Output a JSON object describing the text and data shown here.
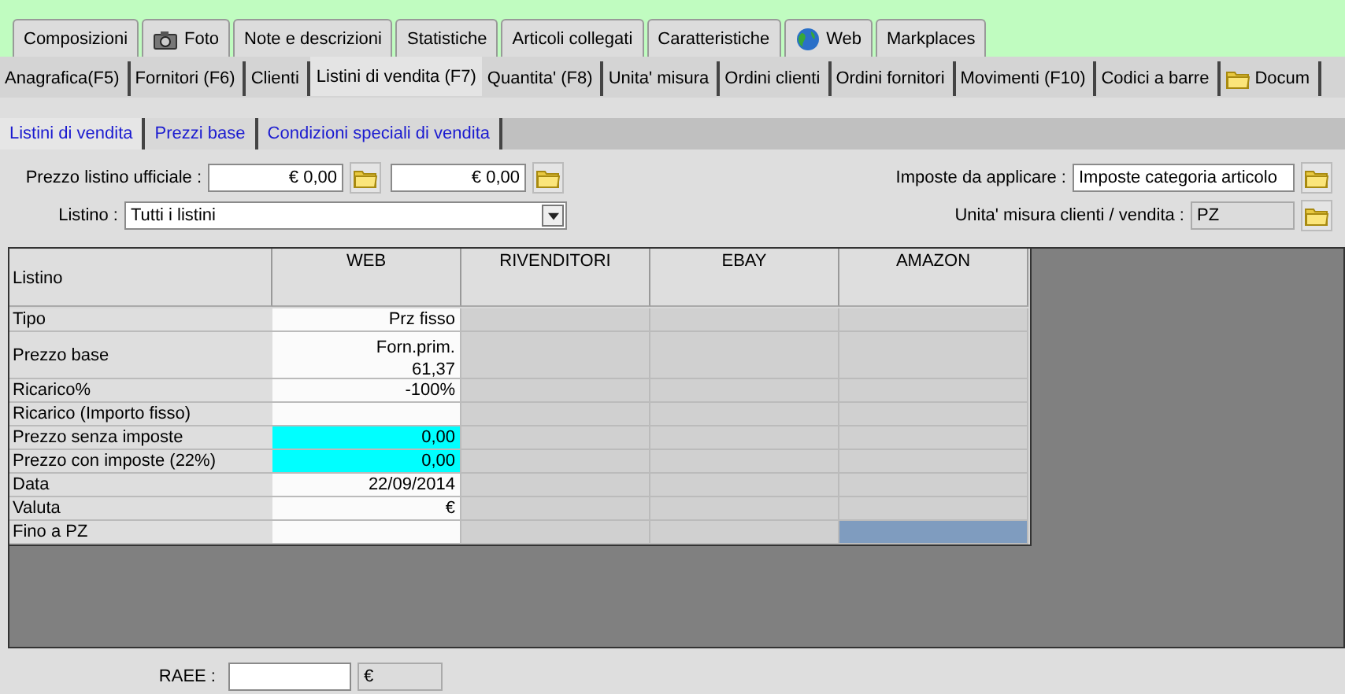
{
  "main_tabs": [
    {
      "label": "Composizioni",
      "kind": "plain",
      "selected": false
    },
    {
      "label": "Foto",
      "kind": "camera",
      "selected": false
    },
    {
      "label": "Note e descrizioni",
      "kind": "plain",
      "selected": false
    },
    {
      "label": "Statistiche",
      "kind": "plain",
      "selected": false
    },
    {
      "label": "Articoli collegati",
      "kind": "plain",
      "selected": false
    },
    {
      "label": "Caratteristiche",
      "kind": "plain",
      "selected": false
    },
    {
      "label": "Web",
      "kind": "globe",
      "selected": false
    },
    {
      "label": "Markplaces",
      "kind": "plain",
      "selected": false
    }
  ],
  "section_tabs": [
    {
      "label": "Anagrafica(F5)",
      "kind": "plain",
      "selected": false
    },
    {
      "label": "Fornitori (F6)",
      "kind": "plain",
      "selected": false
    },
    {
      "label": "Clienti",
      "kind": "plain",
      "selected": false
    },
    {
      "label": "Listini di vendita (F7)",
      "kind": "plain",
      "selected": true
    },
    {
      "label": "Quantita' (F8)",
      "kind": "plain",
      "selected": false
    },
    {
      "label": "Unita' misura",
      "kind": "plain",
      "selected": false
    },
    {
      "label": "Ordini clienti",
      "kind": "plain",
      "selected": false
    },
    {
      "label": "Ordini fornitori",
      "kind": "plain",
      "selected": false
    },
    {
      "label": "Movimenti (F10)",
      "kind": "plain",
      "selected": false
    },
    {
      "label": "Codici a barre",
      "kind": "plain",
      "selected": false
    },
    {
      "label": "Docum",
      "kind": "folder",
      "selected": false
    }
  ],
  "sub_tabs": [
    {
      "label": "Listini di vendita",
      "selected": true
    },
    {
      "label": "Prezzi base",
      "selected": false
    },
    {
      "label": "Condizioni speciali di vendita",
      "selected": false
    }
  ],
  "official_price": {
    "label": "Prezzo listino ufficiale :",
    "value_1": "€ 0,00",
    "value_2": "€ 0,00"
  },
  "price_list": {
    "label": "Listino :",
    "value": "Tutti i listini"
  },
  "taxes": {
    "label": "Imposte da applicare :",
    "value": "Imposte categoria articolo"
  },
  "unit": {
    "label": "Unita' misura clienti / vendita :",
    "value": "PZ"
  },
  "grid": {
    "corner": "Listino",
    "columns": [
      {
        "label": "WEB",
        "enabled": true
      },
      {
        "label": "RIVENDITORI",
        "enabled": false
      },
      {
        "label": "EBAY",
        "enabled": false
      },
      {
        "label": "AMAZON",
        "enabled": false
      }
    ],
    "rows": [
      {
        "label": "Tipo",
        "cells": [
          {
            "text": "Prz fisso",
            "highlighted": false,
            "selected": false
          },
          {
            "highlighted": false,
            "selected": false
          },
          {
            "highlighted": false,
            "selected": false
          },
          {
            "highlighted": false,
            "selected": false
          }
        ]
      },
      {
        "label": "Prezzo base",
        "cells": [
          {
            "text": "Forn.prim.\n61,37",
            "highlighted": false,
            "selected": false
          },
          {
            "highlighted": false,
            "selected": false
          },
          {
            "highlighted": false,
            "selected": false
          },
          {
            "highlighted": false,
            "selected": false
          }
        ]
      },
      {
        "label": "Ricarico%",
        "cells": [
          {
            "text": "-100%",
            "highlighted": false,
            "selected": false
          },
          {
            "highlighted": false,
            "selected": false
          },
          {
            "highlighted": false,
            "selected": false
          },
          {
            "highlighted": false,
            "selected": false
          }
        ]
      },
      {
        "label": "Ricarico (Importo fisso)",
        "cells": [
          {
            "highlighted": false,
            "selected": false
          },
          {
            "highlighted": false,
            "selected": false
          },
          {
            "highlighted": false,
            "selected": false
          },
          {
            "highlighted": false,
            "selected": false
          }
        ]
      },
      {
        "label": "Prezzo senza imposte",
        "cells": [
          {
            "text": "0,00",
            "highlighted": true,
            "selected": false
          },
          {
            "highlighted": false,
            "selected": false
          },
          {
            "highlighted": false,
            "selected": false
          },
          {
            "highlighted": false,
            "selected": false
          }
        ]
      },
      {
        "label": "Prezzo con imposte (22%)",
        "cells": [
          {
            "text": "0,00",
            "highlighted": true,
            "selected": false
          },
          {
            "highlighted": false,
            "selected": false
          },
          {
            "highlighted": false,
            "selected": false
          },
          {
            "highlighted": false,
            "selected": false
          }
        ]
      },
      {
        "label": "Data",
        "cells": [
          {
            "text": "22/09/2014",
            "highlighted": false,
            "selected": false
          },
          {
            "highlighted": false,
            "selected": false
          },
          {
            "highlighted": false,
            "selected": false
          },
          {
            "highlighted": false,
            "selected": false
          }
        ]
      },
      {
        "label": "Valuta",
        "cells": [
          {
            "text": "€",
            "highlighted": false,
            "selected": false
          },
          {
            "highlighted": false,
            "selected": false
          },
          {
            "highlighted": false,
            "selected": false
          },
          {
            "highlighted": false,
            "selected": false
          }
        ]
      },
      {
        "label": "Fino a PZ",
        "cells": [
          {
            "highlighted": false,
            "selected": false
          },
          {
            "highlighted": false,
            "selected": false
          },
          {
            "highlighted": false,
            "selected": false
          },
          {
            "highlighted": false,
            "selected": true
          }
        ]
      }
    ]
  },
  "raee": {
    "label": "RAEE :",
    "currency": "€"
  }
}
